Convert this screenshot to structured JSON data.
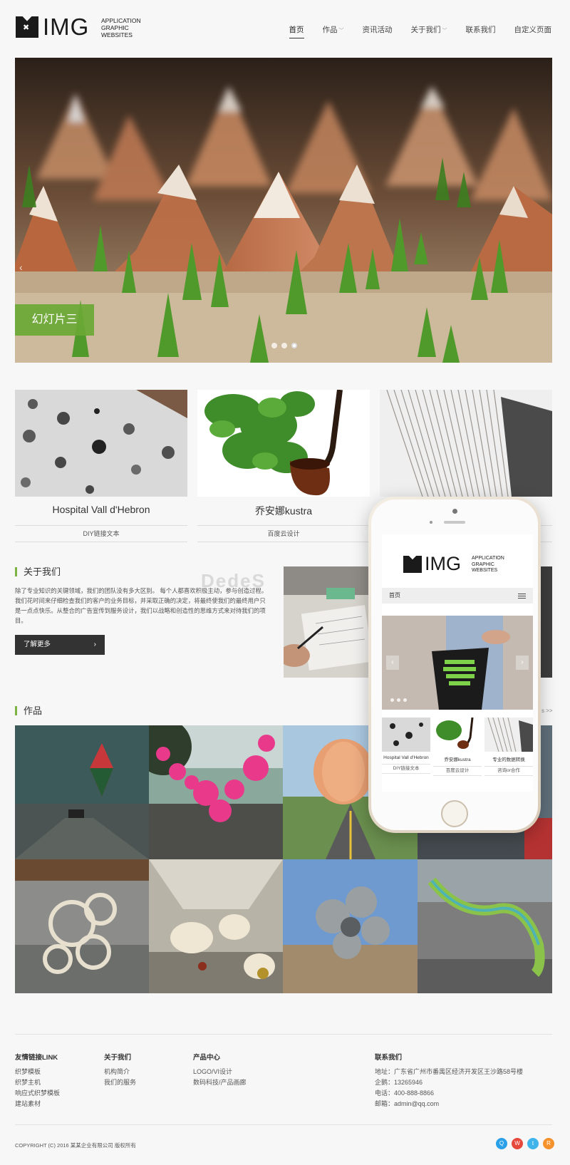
{
  "header": {
    "logo_text": "IMG",
    "logo_sub": [
      "APPLICATION",
      "GRAPHIC",
      "WEBSITES"
    ],
    "nav": [
      {
        "label": "首页",
        "active": true,
        "dropdown": false
      },
      {
        "label": "作品",
        "active": false,
        "dropdown": true
      },
      {
        "label": "资讯活动",
        "active": false,
        "dropdown": false
      },
      {
        "label": "关于我们",
        "active": false,
        "dropdown": true
      },
      {
        "label": "联系我们",
        "active": false,
        "dropdown": false
      },
      {
        "label": "自定义页面",
        "active": false,
        "dropdown": false
      }
    ]
  },
  "hero": {
    "caption": "幻灯片三",
    "prev_icon": "‹",
    "slide_count": 3,
    "active_slide": 3
  },
  "products": [
    {
      "title": "Hospital Vall d'Hebron",
      "link": "DIY链接文本"
    },
    {
      "title": "乔安娜kustra",
      "link": "百度云设计"
    },
    {
      "title": "",
      "link": ""
    }
  ],
  "about": {
    "title": "关于我们",
    "text": "除了专业知识的关键领域，我们的团队没有多大区别。 每个人都喜欢积极主动，参与创造过程。我们花时间来仔细检查我们的客户的业务目标，并采取正确的决定，将最终使我们的最终用户只是一点点快乐。从整合的广告宣传到服务设计，我们以战略和创造性的思维方式来对待我们的项目。",
    "button": "了解更多",
    "button_icon": "›"
  },
  "watermark": "DedeS",
  "works": {
    "title": "作品",
    "more": "s >>"
  },
  "phone": {
    "logo_text": "IMG",
    "logo_sub": [
      "APPLICATION",
      "GRAPHIC",
      "WEBSITES"
    ],
    "nav_label": "首页",
    "prev": "‹",
    "next": "›",
    "cards": [
      {
        "title": "Hospital Vall d'Hebron",
        "link": "DIY链接文本"
      },
      {
        "title": "乔安娜kustra",
        "link": "百度云设计"
      },
      {
        "title": "专业的数据转换",
        "link": "咨询or合作"
      }
    ]
  },
  "footer": {
    "cols": [
      {
        "heading": "友情链接LINK",
        "items": [
          "织梦模板",
          "织梦主机",
          "响应式织梦模板",
          "建站素材"
        ]
      },
      {
        "heading": "关于我们",
        "items": [
          "机构简介",
          "我们的服务"
        ]
      },
      {
        "heading": "产品中心",
        "items": [
          "LOGO/VI设计",
          "数码科技/产品画廊"
        ]
      },
      {
        "heading": "联系我们",
        "items": [
          "地址：广东省广州市番禺区经济开发区王沙路58号楼",
          "企鹅：13265946",
          "电话：400-888-8866",
          "邮箱：admin@qq.com"
        ]
      }
    ],
    "copyright": "COPYRIGHT (C) 2016 某某企业有限公司 版权所有",
    "social": [
      {
        "name": "qq-icon",
        "color": "#2aa0e8",
        "glyph": "Q"
      },
      {
        "name": "weibo-icon",
        "color": "#e6483b",
        "glyph": "W"
      },
      {
        "name": "twitter-icon",
        "color": "#3fb4ea",
        "glyph": "t"
      },
      {
        "name": "rss-icon",
        "color": "#f5922b",
        "glyph": "R"
      }
    ]
  },
  "colors": {
    "accent_green": "#7cb342",
    "caption_green": "#6aa835",
    "button_dark": "#333333"
  }
}
